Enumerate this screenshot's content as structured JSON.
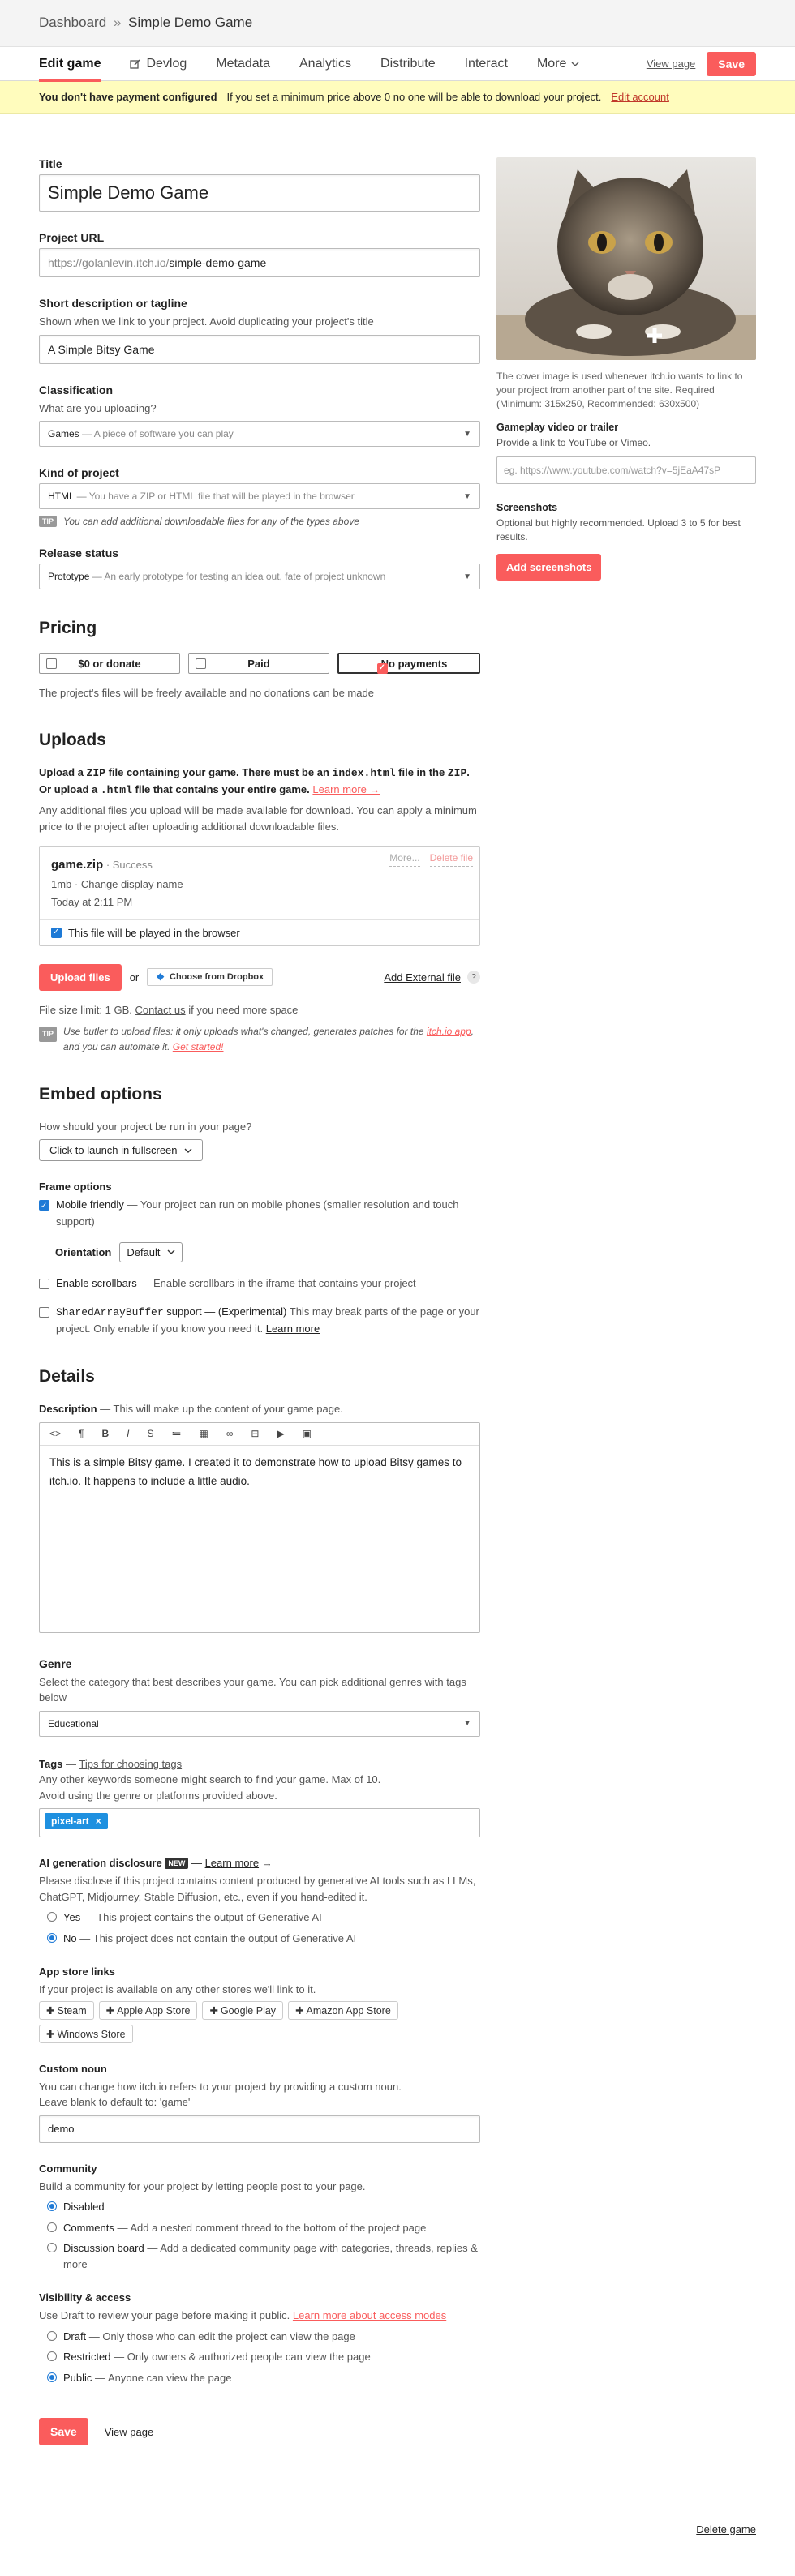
{
  "breadcrumb": {
    "root": "Dashboard",
    "sep": "»",
    "current": "Simple Demo Game"
  },
  "tabs": [
    {
      "label": "Edit game",
      "icon": ""
    },
    {
      "label": "Devlog",
      "icon": "edit-icon"
    },
    {
      "label": "Metadata",
      "icon": ""
    },
    {
      "label": "Analytics",
      "icon": ""
    },
    {
      "label": "Distribute",
      "icon": ""
    },
    {
      "label": "Interact",
      "icon": ""
    },
    {
      "label": "More",
      "icon": "chevron-down-icon"
    }
  ],
  "header_actions": {
    "view_page": "View page",
    "save": "Save"
  },
  "banner": {
    "title": "You don't have payment configured",
    "text": "If you set a minimum price above 0 no one will be able to download your project.",
    "link": "Edit account"
  },
  "title_field": {
    "label": "Title",
    "value": "Simple Demo Game"
  },
  "url_field": {
    "label": "Project URL",
    "prefix": "https://golanlevin.itch.io/",
    "slug": "simple-demo-game"
  },
  "short_desc": {
    "label": "Short description or tagline",
    "help": "Shown when we link to your project. Avoid duplicating your project's title",
    "value": "A Simple Bitsy Game"
  },
  "classification": {
    "label": "Classification",
    "help": "What are you uploading?",
    "value": "Games",
    "desc": "— A piece of software you can play"
  },
  "kind": {
    "label": "Kind of project",
    "value": "HTML",
    "desc": "— You have a ZIP or HTML file that will be played in the browser",
    "tip_badge": "TIP",
    "tip": "You can add additional downloadable files for any of the types above"
  },
  "release": {
    "label": "Release status",
    "value": "Prototype",
    "desc": "— An early prototype for testing an idea out, fate of project unknown"
  },
  "pricing": {
    "heading": "Pricing",
    "options": [
      "$0 or donate",
      "Paid",
      "No payments"
    ],
    "selected": "No payments",
    "note": "The project's files will be freely available and no donations can be made"
  },
  "uploads": {
    "heading": "Uploads",
    "instr_1": "Upload a",
    "zip": "ZIP",
    "instr_2": "file containing your game. There must be an",
    "index": "index.html",
    "instr_3": "file in the",
    "zip2": "ZIP",
    "instr_4": ". Or upload a",
    "html": ".html",
    "instr_5": "file that contains your entire game.",
    "learn_more": "Learn more →",
    "additional": "Any additional files you upload will be made available for download. You can apply a minimum price to the project after uploading additional downloadable files.",
    "file": {
      "name": "game.zip",
      "status": "· Success",
      "size": "1mb",
      "change_name": "Change display name",
      "date": "Today at 2:11 PM",
      "more": "More...",
      "delete": "Delete file",
      "browser_check": "This file will be played in the browser"
    },
    "upload_button": "Upload files",
    "or": "or",
    "dropbox": "Choose from Dropbox",
    "external": "Add External file",
    "help_mark": "?",
    "limit_1": "File size limit: 1 GB.",
    "contact": "Contact us",
    "limit_2": "if you need more space",
    "butler_badge": "TIP",
    "butler_1": "Use butler to upload files: it only uploads what's changed, generates patches for the",
    "butler_link": "itch.io app",
    "butler_2": ", and you can automate it.",
    "butler_start": "Get started!"
  },
  "embed": {
    "heading": "Embed options",
    "question": "How should your project be run in your page?",
    "mode": "Click to launch in fullscreen",
    "frame_label": "Frame options",
    "mobile_title": "Mobile friendly",
    "mobile_desc": "— Your project can run on mobile phones (smaller resolution and touch support)",
    "orientation_label": "Orientation",
    "orientation_value": "Default",
    "scroll_title": "Enable scrollbars",
    "scroll_desc": "— Enable scrollbars in the iframe that contains your project",
    "sab_code": "SharedArrayBuffer",
    "sab_title": "support — (Experimental)",
    "sab_desc": "This may break parts of the page or your project. Only enable if you know you need it.",
    "sab_learn": "Learn more"
  },
  "details": {
    "heading": "Details",
    "desc_label": "Description",
    "desc_help": "— This will make up the content of your game page.",
    "toolbar": [
      "<>",
      "¶",
      "B",
      "I",
      "S",
      "≔",
      "▦",
      "∞",
      "⊟",
      "▶",
      "▣"
    ],
    "content": "This is a simple Bitsy game. I created it to demonstrate how to upload Bitsy games to itch.io. It happens to include a little audio."
  },
  "genre": {
    "label": "Genre",
    "help": "Select the category that best describes your game. You can pick additional genres with tags below",
    "value": "Educational"
  },
  "tags": {
    "label": "Tags",
    "link": "Tips for choosing tags",
    "help_1": "Any other keywords someone might search to find your game. Max of 10.",
    "help_2": "Avoid using the genre or platforms provided above.",
    "items": [
      "pixel-art"
    ]
  },
  "ai": {
    "label": "AI generation disclosure",
    "badge": "NEW",
    "learn": "Learn more",
    "arrow": "→",
    "help": "Please disclose if this project contains content produced by generative AI tools such as LLMs, ChatGPT, Midjourney, Stable Diffusion, etc., even if you hand-edited it.",
    "yes_title": "Yes",
    "yes_desc": "— This project contains the output of Generative AI",
    "no_title": "No",
    "no_desc": "— This project does not contain the output of Generative AI",
    "selected": "No"
  },
  "stores": {
    "label": "App store links",
    "help": "If your project is available on any other stores we'll link to it.",
    "items": [
      "Steam",
      "Apple App Store",
      "Google Play",
      "Amazon App Store",
      "Windows Store"
    ]
  },
  "noun": {
    "label": "Custom noun",
    "help_1": "You can change how itch.io refers to your project by providing a custom noun.",
    "help_2": "Leave blank to default to: 'game'",
    "value": "demo"
  },
  "community": {
    "label": "Community",
    "help": "Build a community for your project by letting people post to your page.",
    "options": [
      {
        "title": "Disabled",
        "desc": ""
      },
      {
        "title": "Comments",
        "desc": "— Add a nested comment thread to the bottom of the project page"
      },
      {
        "title": "Discussion board",
        "desc": "— Add a dedicated community page with categories, threads, replies & more"
      }
    ],
    "selected": "Disabled"
  },
  "visibility": {
    "label": "Visibility & access",
    "help": "Use Draft to review your page before making it public.",
    "link": "Learn more about access modes",
    "options": [
      {
        "title": "Draft",
        "desc": "— Only those who can edit the project can view the page"
      },
      {
        "title": "Restricted",
        "desc": "— Only owners & authorized people can view the page"
      },
      {
        "title": "Public",
        "desc": "— Anyone can view the page"
      }
    ],
    "selected": "Public"
  },
  "footer": {
    "save": "Save",
    "view": "View page",
    "delete": "Delete game"
  },
  "sidebar": {
    "cover_note": "The cover image is used whenever itch.io wants to link to your project from another part of the site. Required (Minimum: 315x250, Recommended: 630x500)",
    "video_label": "Gameplay video or trailer",
    "video_help": "Provide a link to YouTube or Vimeo.",
    "video_placeholder": "eg. https://www.youtube.com/watch?v=5jEaA47sP",
    "shots_label": "Screenshots",
    "shots_help": "Optional but highly recommended. Upload 3 to 5 for best results.",
    "shots_button": "Add screenshots"
  },
  "colors": {
    "accent": "#fa5c5c",
    "banner": "#fffcbd",
    "link_blue": "#1e7ad6",
    "tag": "#1e90e0"
  }
}
